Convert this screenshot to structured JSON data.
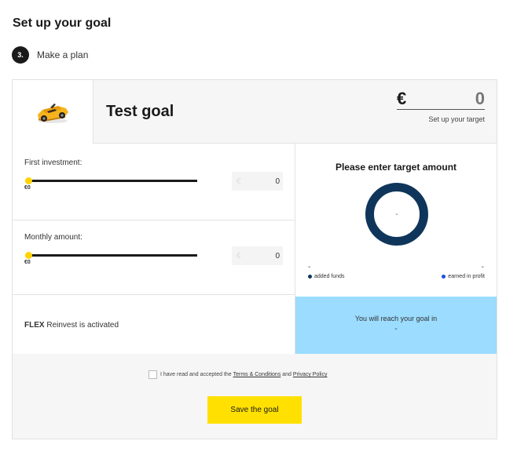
{
  "page": {
    "title": "Set up your goal"
  },
  "step": {
    "number": "3.",
    "label": "Make a plan"
  },
  "goal": {
    "name": "Test goal",
    "image_icon": "convertible-car-icon",
    "currency": "€",
    "target_value": "0",
    "target_hint": "Set up your target"
  },
  "first_investment": {
    "label": "First investment:",
    "slider_min": "€0",
    "slider_level": 0,
    "currency": "€",
    "value": "0"
  },
  "monthly_amount": {
    "label": "Monthly amount:",
    "slider_min": "€0",
    "slider_level": 0,
    "currency": "€",
    "value": "0"
  },
  "flex": {
    "bold": "FLEX",
    "text": " Reinvest is activated"
  },
  "summary": {
    "title": "Please enter target amount",
    "donut_value": "-",
    "added_funds_value": "-",
    "earned_profit_value": "-",
    "added_funds_label": "added funds",
    "earned_profit_label": "earned in profit",
    "added_funds_color": "#0f365a",
    "earned_profit_color": "#1f4fe0"
  },
  "reach": {
    "label": "You will reach your goal in",
    "value": "-"
  },
  "agreement": {
    "prefix": "I have read and accepted the ",
    "terms_link": "Terms & Conditions",
    "middle": " and ",
    "privacy_link": "Privacy Policy",
    "checked": false
  },
  "save_button": {
    "label": "Save the goal"
  },
  "colors": {
    "accent": "#ffe000",
    "navy": "#0f365a",
    "reach_bg": "#9bdcff",
    "slider_thumb": "#ffd400"
  }
}
